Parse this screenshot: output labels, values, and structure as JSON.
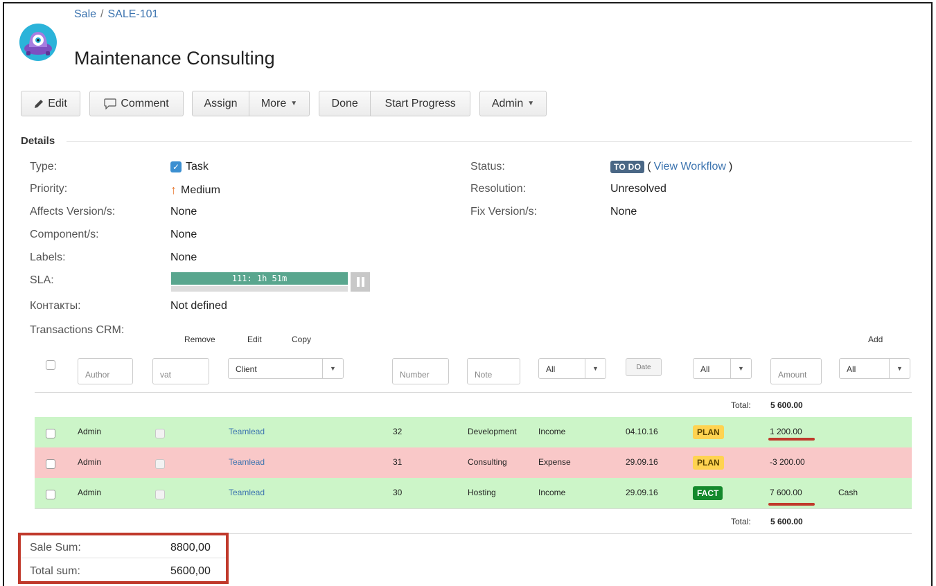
{
  "breadcrumb": {
    "project": "Sale",
    "separator": "/",
    "issue_key": "SALE-101"
  },
  "title": "Maintenance Consulting",
  "toolbar": {
    "edit": "Edit",
    "comment": "Comment",
    "assign": "Assign",
    "more": "More",
    "done": "Done",
    "start_progress": "Start Progress",
    "admin": "Admin"
  },
  "details": {
    "heading": "Details",
    "type_label": "Type:",
    "type_value": "Task",
    "priority_label": "Priority:",
    "priority_value": "Medium",
    "affects_label": "Affects Version/s:",
    "affects_value": "None",
    "component_label": "Component/s:",
    "component_value": "None",
    "labels_label": "Labels:",
    "labels_value": "None",
    "sla_label": "SLA:",
    "sla_value": "111: 1h 51m",
    "contacts_label": "Контакты:",
    "contacts_value": "Not defined",
    "transactions_label": "Transactions CRM:",
    "status_label": "Status:",
    "status_value": "TO DO",
    "view_workflow": "View Workflow",
    "resolution_label": "Resolution:",
    "resolution_value": "Unresolved",
    "fix_label": "Fix Version/s:",
    "fix_value": "None"
  },
  "transactions": {
    "actions": {
      "remove": "Remove",
      "edit": "Edit",
      "copy": "Copy",
      "add": "Add"
    },
    "filters": {
      "author_placeholder": "Author",
      "vat_placeholder": "vat",
      "client": "Client",
      "number_placeholder": "Number",
      "note_placeholder": "Note",
      "type_all": "All",
      "date": "Date",
      "status_all": "All",
      "amount_placeholder": "Amount",
      "account_all": "All"
    },
    "total_label": "Total:",
    "total_value": "5 600.00",
    "rows": [
      {
        "author": "Admin",
        "client": "Teamlead",
        "number": "32",
        "note": "Development",
        "type": "Income",
        "date": "04.10.16",
        "status": "PLAN",
        "amount": "1 200.00",
        "account": ""
      },
      {
        "author": "Admin",
        "client": "Teamlead",
        "number": "31",
        "note": "Consulting",
        "type": "Expense",
        "date": "29.09.16",
        "status": "PLAN",
        "amount": "-3 200.00",
        "account": ""
      },
      {
        "author": "Admin",
        "client": "Teamlead",
        "number": "30",
        "note": "Hosting",
        "type": "Income",
        "date": "29.09.16",
        "status": "FACT",
        "amount": "7 600.00",
        "account": "Cash"
      }
    ]
  },
  "sums": {
    "sale_label": "Sale Sum:",
    "sale_value": "8800,00",
    "total_label": "Total sum:",
    "total_value": "5600,00"
  },
  "colors": {
    "income_row": "#ccf5c8",
    "expense_row": "#f9c8c8",
    "plan_badge": "#ffd351",
    "fact_badge": "#14892c",
    "highlight": "#c0392b",
    "link": "#3b73af"
  }
}
